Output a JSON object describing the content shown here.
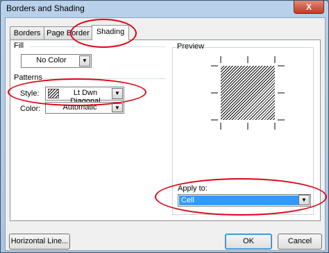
{
  "window": {
    "title": "Borders and Shading",
    "close_glyph": "X"
  },
  "tabs": [
    {
      "label": "Borders",
      "active": false
    },
    {
      "label": "Page Border",
      "active": false
    },
    {
      "label": "Shading",
      "active": true
    }
  ],
  "fill": {
    "section_label": "Fill",
    "color_value": "No Color"
  },
  "patterns": {
    "section_label": "Patterns",
    "style_label": "Style:",
    "style_value": "Lt Dwn Diagonal",
    "color_label": "Color:",
    "color_value": "Automatic"
  },
  "preview": {
    "section_label": "Preview",
    "apply_to_label": "Apply to:",
    "apply_to_value": "Cell"
  },
  "buttons": {
    "horizontal_line": "Horizontal Line...",
    "ok": "OK",
    "cancel": "Cancel"
  },
  "icons": {
    "dropdown_arrow": "▼"
  },
  "colors": {
    "selection": "#3399ff",
    "annotation": "#e00012"
  }
}
